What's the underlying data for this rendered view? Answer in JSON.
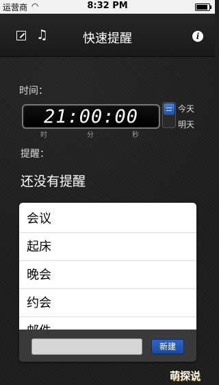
{
  "status_bar": {
    "carrier": "运营商",
    "wifi_icon": "wifi-icon",
    "time": "8:32 PM",
    "battery_icon": "battery-icon"
  },
  "nav": {
    "title": "快速提醒",
    "edit_icon": "edit-icon",
    "music_icon": "music-note-icon",
    "music_glyph": "♫",
    "info_icon": "info-icon",
    "info_glyph": "i"
  },
  "time_section": {
    "label": "时间：",
    "clock_value": "21:00:00",
    "units": [
      "时",
      "分",
      "秒"
    ],
    "day_options": [
      "今天",
      "明天"
    ],
    "selected_day": "今天"
  },
  "remind_section": {
    "label": "提醒：",
    "value": "还没有提醒"
  },
  "preset_list": {
    "items": [
      "会议",
      "起床",
      "晚会",
      "约会",
      "邮件"
    ],
    "input_placeholder": "",
    "new_button_label": "新建"
  },
  "watermark": "萌探说",
  "colors": {
    "accent_blue": "#2f66c4",
    "background": "#1d1d1d"
  }
}
